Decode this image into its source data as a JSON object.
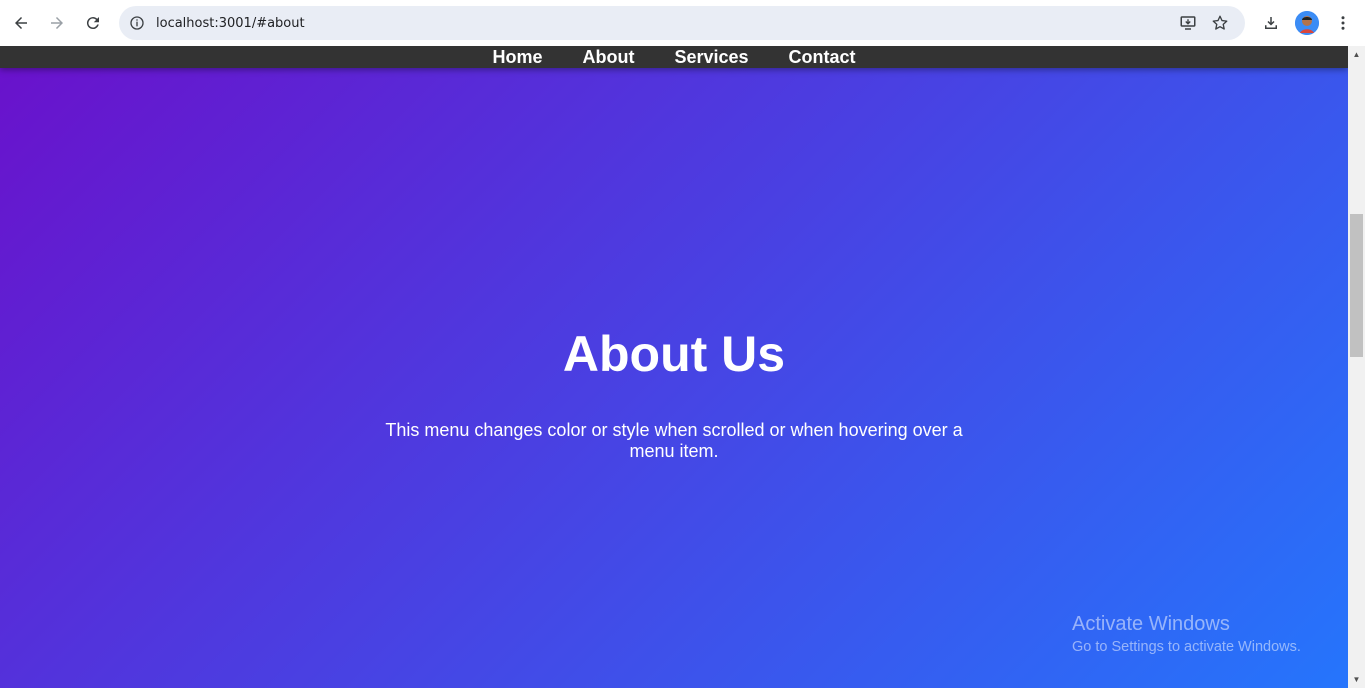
{
  "browser": {
    "url": "localhost:3001/#about",
    "icons": {
      "back": "arrow-left-icon",
      "forward": "arrow-right-icon",
      "reload": "reload-icon",
      "info": "info-icon",
      "install": "install-app-icon",
      "bookmark": "star-icon",
      "downloads": "download-icon",
      "profile": "avatar",
      "menu": "kebab-menu-icon"
    }
  },
  "nav": {
    "items": [
      {
        "label": "Home"
      },
      {
        "label": "About"
      },
      {
        "label": "Services"
      },
      {
        "label": "Contact"
      }
    ],
    "background": "#333333"
  },
  "about": {
    "title": "About Us",
    "text": "This menu changes color or style when scrolled or when hovering over a menu item."
  },
  "watermark": {
    "title": "Activate Windows",
    "subtitle": "Go to Settings to activate Windows."
  },
  "colors": {
    "gradient_start": "#6a11cb",
    "gradient_end": "#2575fc"
  }
}
